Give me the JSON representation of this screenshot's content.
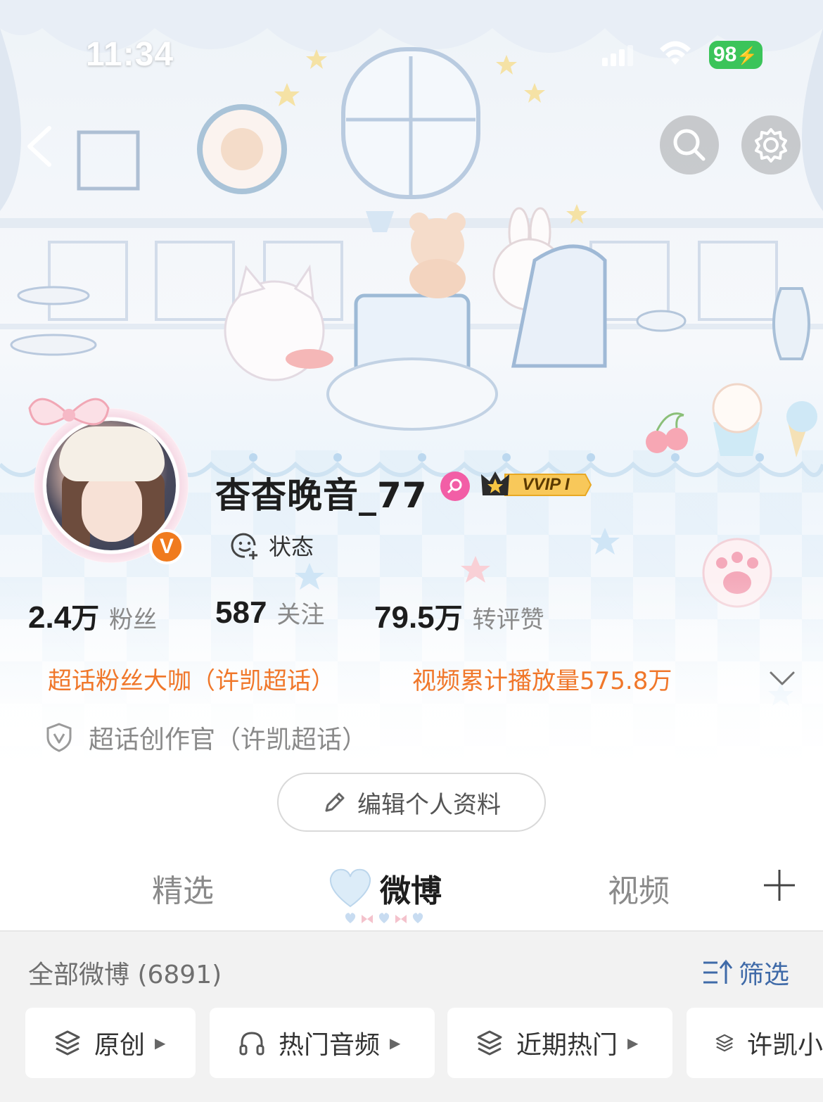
{
  "status_bar": {
    "time": "11:34",
    "battery": "98"
  },
  "profile": {
    "username": "杳杳晚音_77",
    "vip_label": "VVIP I",
    "verified_mark": "V",
    "status_label": "状态"
  },
  "stats": [
    {
      "value": "2.4",
      "unit": "万",
      "label": "粉丝"
    },
    {
      "value": "587",
      "unit": "",
      "label": "关注"
    },
    {
      "value": "79.5",
      "unit": "万",
      "label": "转评赞"
    }
  ],
  "tags": {
    "super_fan": "超话粉丝大咖（许凯超话）",
    "video_plays": "视频累计播放量575.8万",
    "creator": "超话创作官（许凯超话）"
  },
  "edit_profile_label": "编辑个人资料",
  "tabs": [
    {
      "label": "精选"
    },
    {
      "label": "微博"
    },
    {
      "label": "视频"
    }
  ],
  "feed": {
    "title": "全部微博 (6891)",
    "filter_label": "筛选",
    "chips": [
      {
        "label": "原创",
        "icon": "layers-icon"
      },
      {
        "label": "热门音频",
        "icon": "headphones-icon"
      },
      {
        "label": "近期热门",
        "icon": "layers-icon"
      },
      {
        "label": "许凯小",
        "icon": "layers-icon"
      }
    ]
  },
  "colors": {
    "accent_orange": "#f0772a",
    "link_blue": "#3f6aa8",
    "verified_orange": "#f07b1e",
    "battery_green": "#3bc45a",
    "gender_pink": "#f25ea6"
  }
}
